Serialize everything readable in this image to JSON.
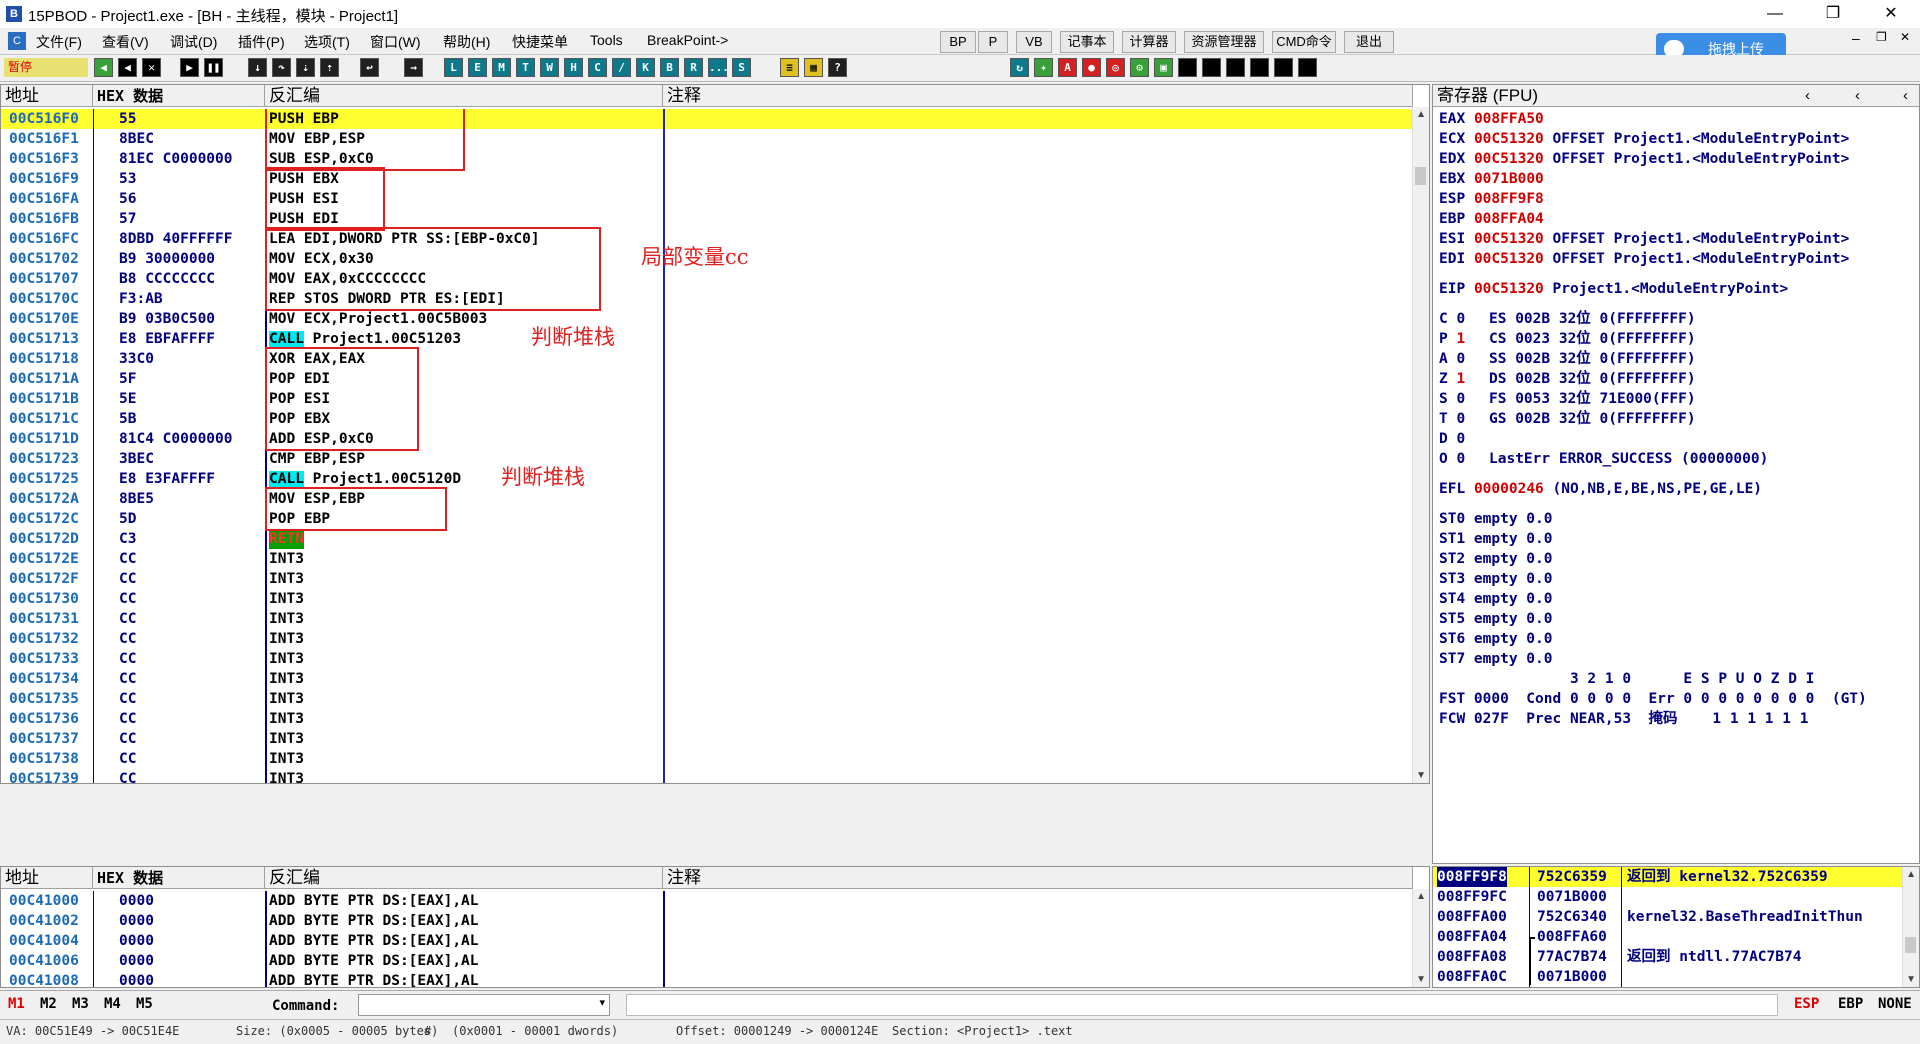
{
  "window": {
    "title": "15PBOD - Project1.exe - [BH - 主线程，模块 - Project1]",
    "controls": {
      "minimize": "—",
      "restore": "❐",
      "close": "✕"
    }
  },
  "menu": {
    "items": [
      "文件(F)",
      "查看(V)",
      "调试(D)",
      "插件(P)",
      "选项(T)",
      "窗口(W)",
      "帮助(H)",
      "快捷菜单",
      "Tools",
      "BreakPoint->"
    ],
    "buttons": [
      "BP",
      "P",
      "VB",
      "记事本",
      "计算器",
      "资源管理器",
      "CMD命令",
      "退出"
    ],
    "upload": "拖拽上传",
    "mdi_controls": [
      "–",
      "❐",
      "✕"
    ]
  },
  "toolbar": {
    "status": "暂停",
    "letters": [
      "L",
      "E",
      "M",
      "T",
      "W",
      "H",
      "C",
      "/",
      "K",
      "B",
      "R",
      "...",
      "S"
    ]
  },
  "cpu": {
    "headers": {
      "addr": "地址",
      "hex": "HEX 数据",
      "disasm": "反汇编",
      "comment": "注释"
    },
    "rows": [
      {
        "addr": "00C516F0",
        "hex": "55",
        "asm": "PUSH EBP"
      },
      {
        "addr": "00C516F1",
        "hex": "8BEC",
        "asm": "MOV EBP,ESP"
      },
      {
        "addr": "00C516F3",
        "hex": "81EC C0000000",
        "asm": "SUB ESP,0xC0"
      },
      {
        "addr": "00C516F9",
        "hex": "53",
        "asm": "PUSH EBX"
      },
      {
        "addr": "00C516FA",
        "hex": "56",
        "asm": "PUSH ESI"
      },
      {
        "addr": "00C516FB",
        "hex": "57",
        "asm": "PUSH EDI"
      },
      {
        "addr": "00C516FC",
        "hex": "8DBD 40FFFFFF",
        "asm": "LEA EDI,DWORD PTR SS:[EBP-0xC0]"
      },
      {
        "addr": "00C51702",
        "hex": "B9 30000000",
        "asm": "MOV ECX,0x30"
      },
      {
        "addr": "00C51707",
        "hex": "B8 CCCCCCCC",
        "asm": "MOV EAX,0xCCCCCCCC"
      },
      {
        "addr": "00C5170C",
        "hex": "F3:AB",
        "asm": "REP STOS DWORD PTR ES:[EDI]"
      },
      {
        "addr": "00C5170E",
        "hex": "B9 03B0C500",
        "asm": "MOV ECX,Project1.00C5B003"
      },
      {
        "addr": "00C51713",
        "hex": "E8 EBFAFFFF",
        "asm": "CALL Project1.00C51203"
      },
      {
        "addr": "00C51718",
        "hex": "33C0",
        "asm": "XOR EAX,EAX"
      },
      {
        "addr": "00C5171A",
        "hex": "5F",
        "asm": "POP EDI"
      },
      {
        "addr": "00C5171B",
        "hex": "5E",
        "asm": "POP ESI"
      },
      {
        "addr": "00C5171C",
        "hex": "5B",
        "asm": "POP EBX"
      },
      {
        "addr": "00C5171D",
        "hex": "81C4 C0000000",
        "asm": "ADD ESP,0xC0"
      },
      {
        "addr": "00C51723",
        "hex": "3BEC",
        "asm": "CMP EBP,ESP"
      },
      {
        "addr": "00C51725",
        "hex": "E8 E3FAFFFF",
        "asm": "CALL Project1.00C5120D"
      },
      {
        "addr": "00C5172A",
        "hex": "8BE5",
        "asm": "MOV ESP,EBP"
      },
      {
        "addr": "00C5172C",
        "hex": "5D",
        "asm": "POP EBP"
      },
      {
        "addr": "00C5172D",
        "hex": "C3",
        "asm": "RETN"
      },
      {
        "addr": "00C5172E",
        "hex": "CC",
        "asm": "INT3"
      },
      {
        "addr": "00C5172F",
        "hex": "CC",
        "asm": "INT3"
      },
      {
        "addr": "00C51730",
        "hex": "CC",
        "asm": "INT3"
      },
      {
        "addr": "00C51731",
        "hex": "CC",
        "asm": "INT3"
      },
      {
        "addr": "00C51732",
        "hex": "CC",
        "asm": "INT3"
      },
      {
        "addr": "00C51733",
        "hex": "CC",
        "asm": "INT3"
      },
      {
        "addr": "00C51734",
        "hex": "CC",
        "asm": "INT3"
      },
      {
        "addr": "00C51735",
        "hex": "CC",
        "asm": "INT3"
      },
      {
        "addr": "00C51736",
        "hex": "CC",
        "asm": "INT3"
      },
      {
        "addr": "00C51737",
        "hex": "CC",
        "asm": "INT3"
      },
      {
        "addr": "00C51738",
        "hex": "CC",
        "asm": "INT3"
      },
      {
        "addr": "00C51739",
        "hex": "CC",
        "asm": "INT3"
      }
    ],
    "annotations": {
      "local_var": "局部变量cc",
      "check_stack_1": "判断堆栈",
      "check_stack_2": "判断堆栈"
    }
  },
  "registers": {
    "header": "寄存器 (FPU)",
    "general": [
      {
        "name": "EAX",
        "value": "008FFA50",
        "comment": ""
      },
      {
        "name": "ECX",
        "value": "00C51320",
        "comment": "OFFSET Project1.<ModuleEntryPoint>"
      },
      {
        "name": "EDX",
        "value": "00C51320",
        "comment": "OFFSET Project1.<ModuleEntryPoint>"
      },
      {
        "name": "EBX",
        "value": "0071B000",
        "comment": ""
      },
      {
        "name": "ESP",
        "value": "008FF9F8",
        "comment": ""
      },
      {
        "name": "EBP",
        "value": "008FFA04",
        "comment": ""
      },
      {
        "name": "ESI",
        "value": "00C51320",
        "comment": "OFFSET Project1.<ModuleEntryPoint>"
      },
      {
        "name": "EDI",
        "value": "00C51320",
        "comment": "OFFSET Project1.<ModuleEntryPoint>"
      }
    ],
    "eip": {
      "name": "EIP",
      "value": "00C51320",
      "comment": "Project1.<ModuleEntryPoint>"
    },
    "flags": [
      {
        "flag": "C 0",
        "seg": "ES 002B 32位 0(FFFFFFFF)"
      },
      {
        "flag": "P 1",
        "seg": "CS 0023 32位 0(FFFFFFFF)"
      },
      {
        "flag": "A 0",
        "seg": "SS 002B 32位 0(FFFFFFFF)"
      },
      {
        "flag": "Z 1",
        "seg": "DS 002B 32位 0(FFFFFFFF)"
      },
      {
        "flag": "S 0",
        "seg": "FS 0053 32位 71E000(FFF)"
      },
      {
        "flag": "T 0",
        "seg": "GS 002B 32位 0(FFFFFFFF)"
      },
      {
        "flag": "D 0",
        "seg": ""
      },
      {
        "flag": "O 0",
        "seg": "LastErr ERROR_SUCCESS (00000000)"
      }
    ],
    "efl": {
      "name": "EFL",
      "value": "00000246",
      "comment": "(NO,NB,E,BE,NS,PE,GE,LE)"
    },
    "fpu": [
      "ST0 empty 0.0",
      "ST1 empty 0.0",
      "ST2 empty 0.0",
      "ST3 empty 0.0",
      "ST4 empty 0.0",
      "ST5 empty 0.0",
      "ST6 empty 0.0",
      "ST7 empty 0.0"
    ],
    "fpu_bits_header": "               3 2 1 0      E S P U O Z D I",
    "fst": "FST 0000  Cond 0 0 0 0  Err 0 0 0 0 0 0 0 0  (GT)",
    "fcw": "FCW 027F  Prec NEAR,53  掩码    1 1 1 1 1 1"
  },
  "dump": {
    "headers": {
      "addr": "地址",
      "hex": "HEX 数据",
      "disasm": "反汇编",
      "comment": "注释"
    },
    "rows": [
      {
        "addr": "00C41000",
        "hex": "0000",
        "asm": "ADD BYTE PTR DS:[EAX],AL"
      },
      {
        "addr": "00C41002",
        "hex": "0000",
        "asm": "ADD BYTE PTR DS:[EAX],AL"
      },
      {
        "addr": "00C41004",
        "hex": "0000",
        "asm": "ADD BYTE PTR DS:[EAX],AL"
      },
      {
        "addr": "00C41006",
        "hex": "0000",
        "asm": "ADD BYTE PTR DS:[EAX],AL"
      },
      {
        "addr": "00C41008",
        "hex": "0000",
        "asm": "ADD BYTE PTR DS:[EAX],AL"
      }
    ]
  },
  "stack": {
    "rows": [
      {
        "addr": "008FF9F8",
        "value": "752C6359",
        "comment": "返回到 kernel32.752C6359"
      },
      {
        "addr": "008FF9FC",
        "value": "0071B000",
        "comment": ""
      },
      {
        "addr": "008FFA00",
        "value": "752C6340",
        "comment": "kernel32.BaseThreadInitThun"
      },
      {
        "addr": "008FFA04",
        "value": "008FFA60",
        "comment": ""
      },
      {
        "addr": "008FFA08",
        "value": "77AC7B74",
        "comment": "返回到 ntdll.77AC7B74"
      },
      {
        "addr": "008FFA0C",
        "value": "0071B000",
        "comment": ""
      }
    ]
  },
  "bottom": {
    "tabs": [
      "M1",
      "M2",
      "M3",
      "M4",
      "M5"
    ],
    "command_label": "Command:",
    "command_value": "",
    "right": [
      "ESP",
      "EBP",
      "NONE"
    ]
  },
  "status": {
    "va": "VA: 00C51E49 -> 00C51E4E",
    "size": "Size: (0x0005 - 00005 bytes)",
    "hash": "#",
    "dwords": "(0x0001 - 00001 dwords)",
    "offset": "Offset: 00001249 -> 0000124E",
    "section": "Section: <Project1> .text"
  }
}
